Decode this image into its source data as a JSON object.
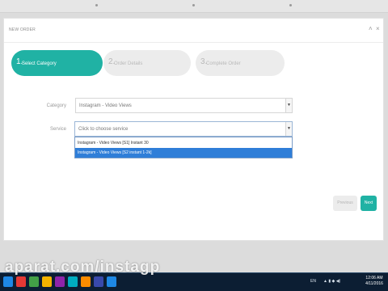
{
  "panel": {
    "title": "NEW ORDER",
    "minimize_glyph": "˄",
    "close_glyph": "×"
  },
  "steps": [
    {
      "number": "1.",
      "label": "Select Category",
      "state": "active"
    },
    {
      "number": "2.",
      "label": "Order Details",
      "state": "inactive"
    },
    {
      "number": "3.",
      "label": "Complete Order",
      "state": "inactive"
    }
  ],
  "form": {
    "category": {
      "label": "Category",
      "value": "Instagram - Video Views"
    },
    "service": {
      "label": "Service",
      "placeholder": "Click to choose service",
      "options": [
        "Instagram - Video Views [S1] Instant 30",
        "Instagram - Video Views [S2 instant 1-2k]"
      ],
      "highlighted_index": 1
    }
  },
  "buttons": {
    "previous": "Previous",
    "next": "Next"
  },
  "watermark": "aparat.com/instagp",
  "taskbar": {
    "tray_lang": "EN",
    "time": "12:06 AM",
    "date": "4/11/2016",
    "icon_colors": [
      "#1e88e5",
      "#e53935",
      "#43a047",
      "#f4b400",
      "#8e24aa",
      "#00acc1",
      "#fb8c00",
      "#3949ab",
      "#1e88e5"
    ]
  },
  "colors": {
    "accent": "#20b2a4",
    "selection": "#2f7ed8",
    "taskbar": "#0c1e33"
  }
}
